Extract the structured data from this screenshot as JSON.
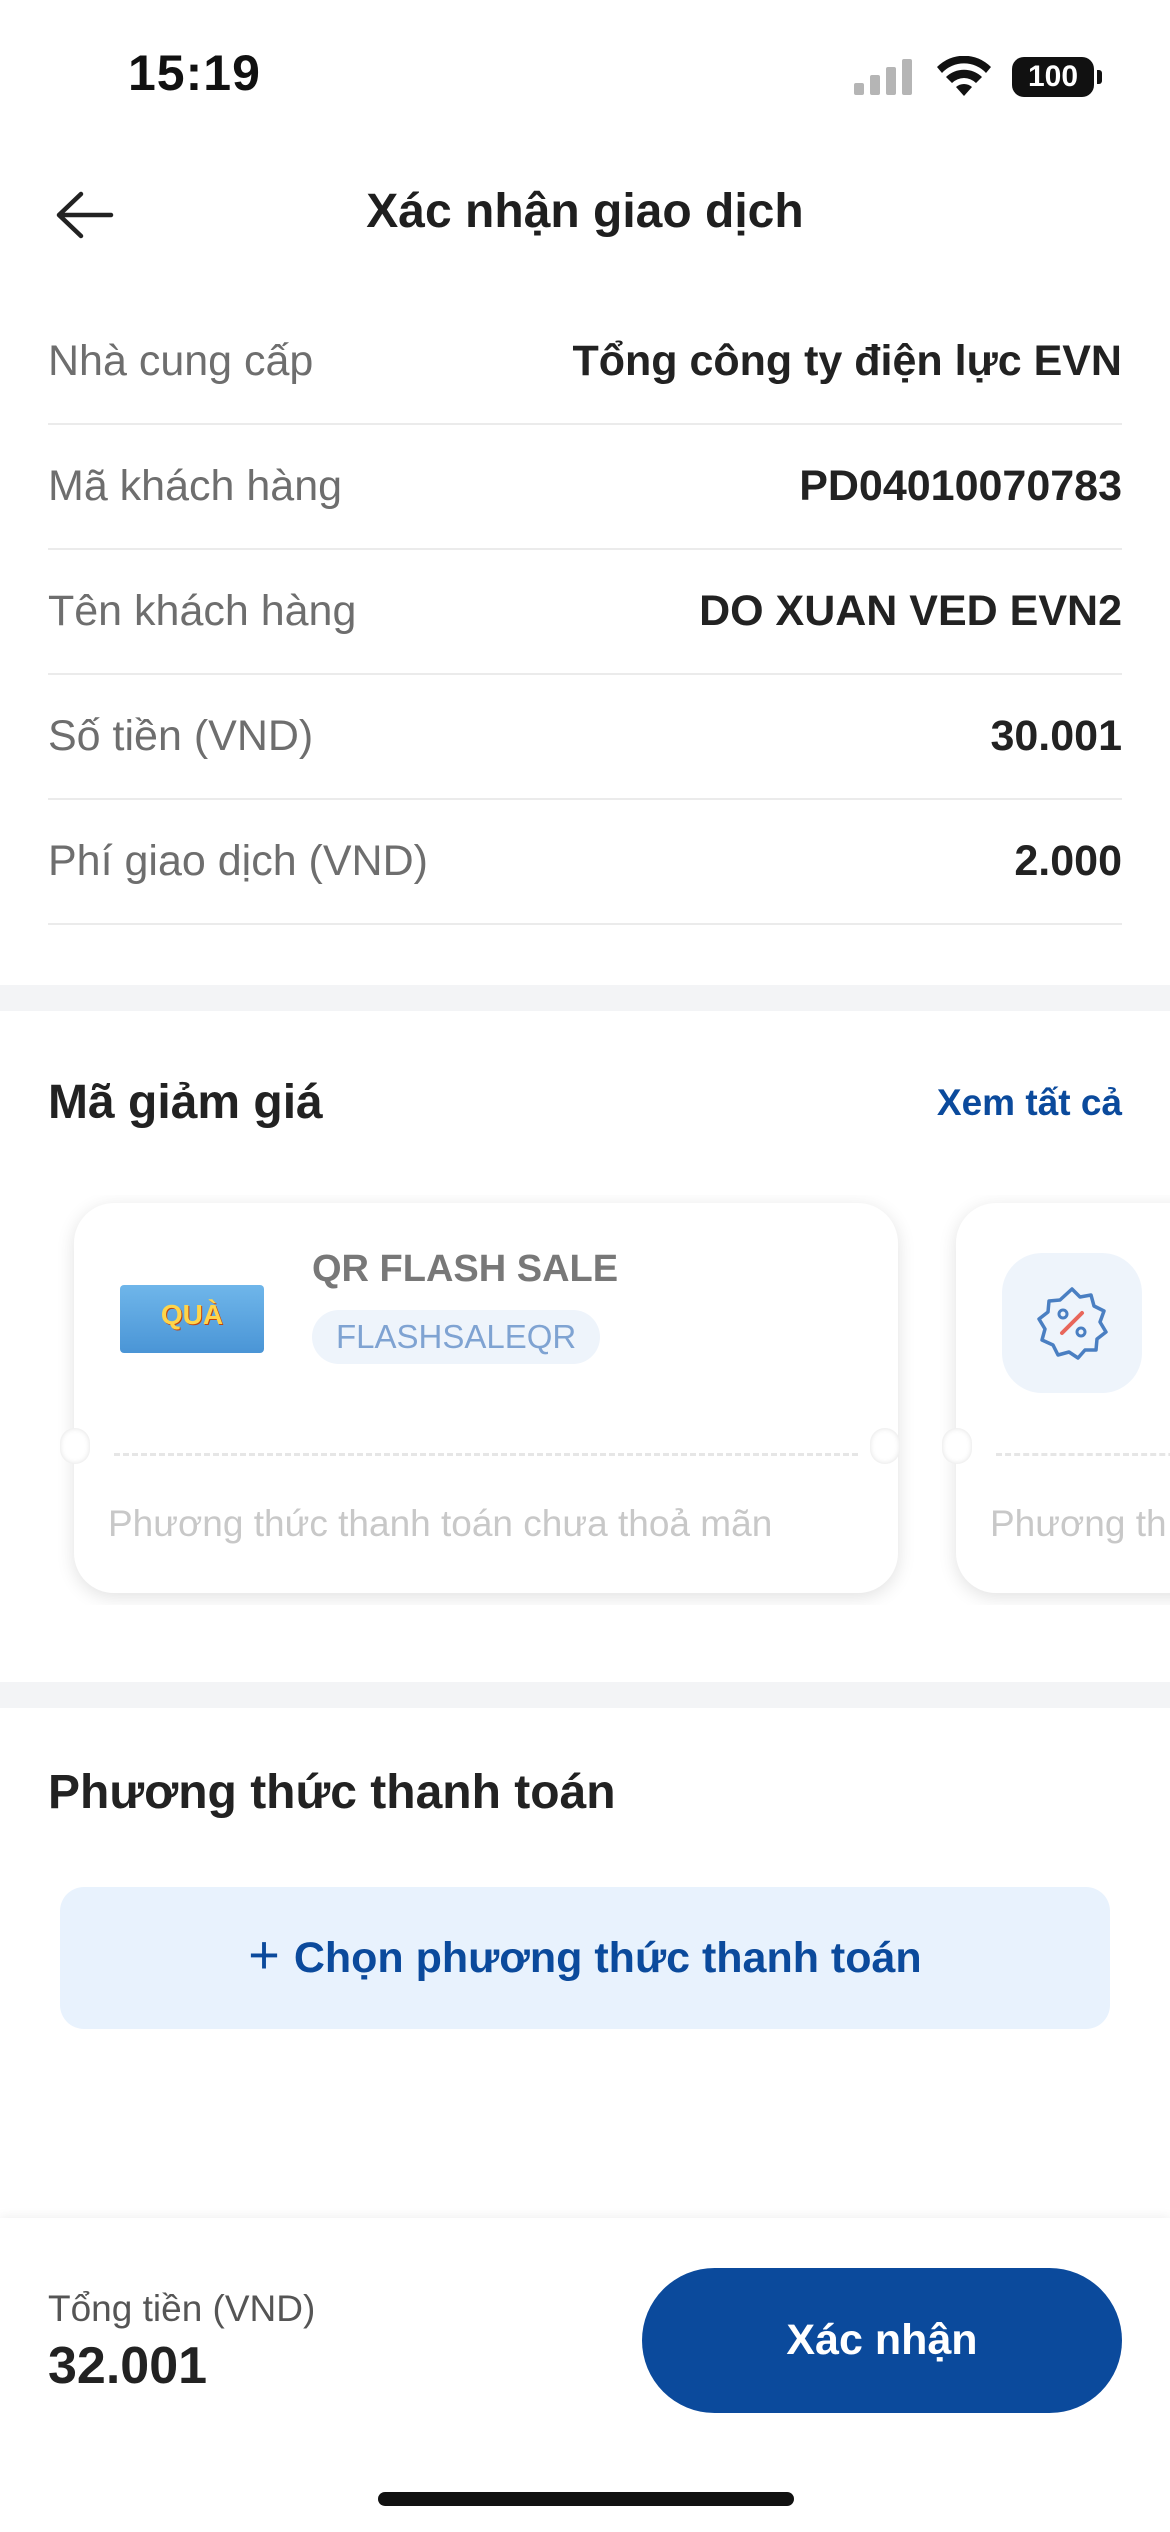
{
  "status_bar": {
    "time": "15:19",
    "battery": "100",
    "icons": [
      "cellular-signal-icon",
      "wifi-icon",
      "battery-icon"
    ]
  },
  "header": {
    "title": "Xác nhận giao dịch",
    "back_icon": "arrow-left-icon"
  },
  "info_rows": [
    {
      "label": "Nhà cung cấp",
      "value": "Tổng công ty điện lực EVN"
    },
    {
      "label": "Mã khách hàng",
      "value": "PD04010070783"
    },
    {
      "label": "Tên khách hàng",
      "value": "DO XUAN VED EVN2"
    },
    {
      "label": "Số tiền (VND)",
      "value": "30.001"
    },
    {
      "label": "Phí giao dịch (VND)",
      "value": "2.000"
    }
  ],
  "vouchers": {
    "title": "Mã giảm giá",
    "see_all": "Xem tất cả",
    "items": [
      {
        "name": "QR FLASH SALE",
        "code": "FLASHSALEQR",
        "note": "Phương thức thanh toán chưa thoả mãn",
        "thumb_text": "QUÀ"
      },
      {
        "icon": "percent-badge-icon",
        "note": "Phương th"
      }
    ]
  },
  "payment": {
    "title": "Phương thức thanh toán",
    "choose_label": "Chọn phương thức thanh toán",
    "plus": "+"
  },
  "footer": {
    "total_label": "Tổng tiền (VND)",
    "total_value": "32.001",
    "confirm_label": "Xác nhận"
  },
  "colors": {
    "primary": "#0b4a9c",
    "light_blue_bg": "#e8f2fd",
    "divider_band": "#f3f4f6"
  }
}
